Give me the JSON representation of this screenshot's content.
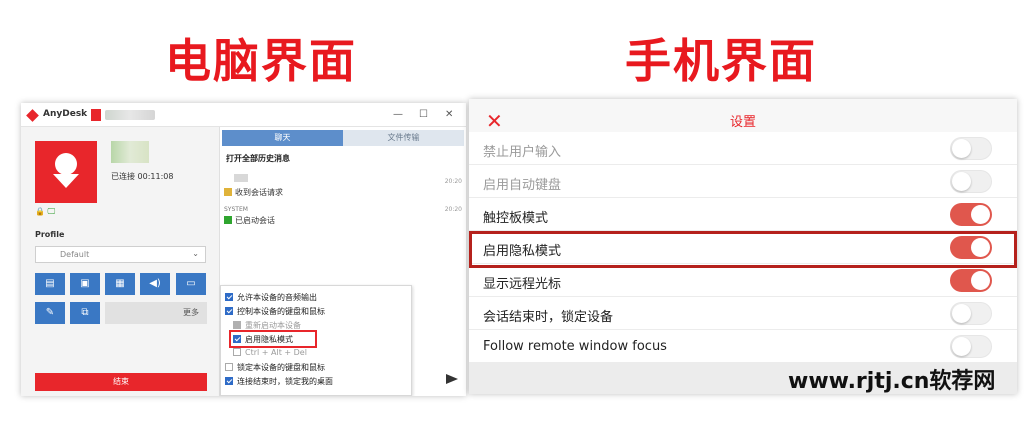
{
  "titles": {
    "pc": "电脑界面",
    "mobile": "手机界面"
  },
  "desktop": {
    "app_name": "AnyDesk",
    "window_controls": {
      "minimize": "—",
      "maximize": "☐",
      "close": "✕"
    },
    "connection_status": "已连接 00:11:08",
    "status_icons": "🔒 🖵",
    "profile_label": "Profile",
    "profile_value": "Default",
    "toolbar_icons": [
      "chat-icon",
      "file-transfer-icon",
      "clipboard-icon",
      "audio-icon",
      "screen-icon",
      "pen-icon",
      "display-switch-icon"
    ],
    "more_label": "更多",
    "end_label": "结束",
    "tabs": {
      "chat": "聊天",
      "file": "文件传输"
    },
    "history_link": "打开全部历史消息",
    "messages": [
      {
        "time": "20:20",
        "text": "收到会话请求",
        "sender": ""
      },
      {
        "time": "20:20",
        "text": "已启动会话",
        "sender": "SYSTEM"
      }
    ],
    "menu": [
      {
        "label": "允许本设备的音频输出",
        "state": "on"
      },
      {
        "label": "控制本设备的键盘和鼠标",
        "state": "on"
      },
      {
        "label": "重新启动本设备",
        "state": "gray"
      },
      {
        "label": "启用隐私模式",
        "state": "on"
      },
      {
        "label": "Ctrl + Alt + Del",
        "state": "blank-disabled"
      },
      {
        "label": "锁定本设备的键盘和鼠标",
        "state": "blank"
      },
      {
        "label": "连接结束时，锁定我的桌面",
        "state": "on"
      }
    ]
  },
  "mobile": {
    "close_glyph": "✕",
    "title": "设置",
    "settings": [
      {
        "label": "禁止用户输入",
        "on": false,
        "dim": true
      },
      {
        "label": "启用自动键盘",
        "on": false,
        "dim": true
      },
      {
        "label": "触控板模式",
        "on": true,
        "dim": false
      },
      {
        "label": "启用隐私模式",
        "on": true,
        "dim": false
      },
      {
        "label": "显示远程光标",
        "on": true,
        "dim": false
      },
      {
        "label": "会话结束时，锁定设备",
        "on": false,
        "dim": false
      },
      {
        "label": "Follow remote window focus",
        "on": false,
        "dim": false
      }
    ]
  },
  "watermark": "www.rjtj.cn软荐网",
  "colors": {
    "accent": "#e8191f",
    "toggle_on": "#e0574d",
    "desk_blue": "#3a78c4"
  }
}
